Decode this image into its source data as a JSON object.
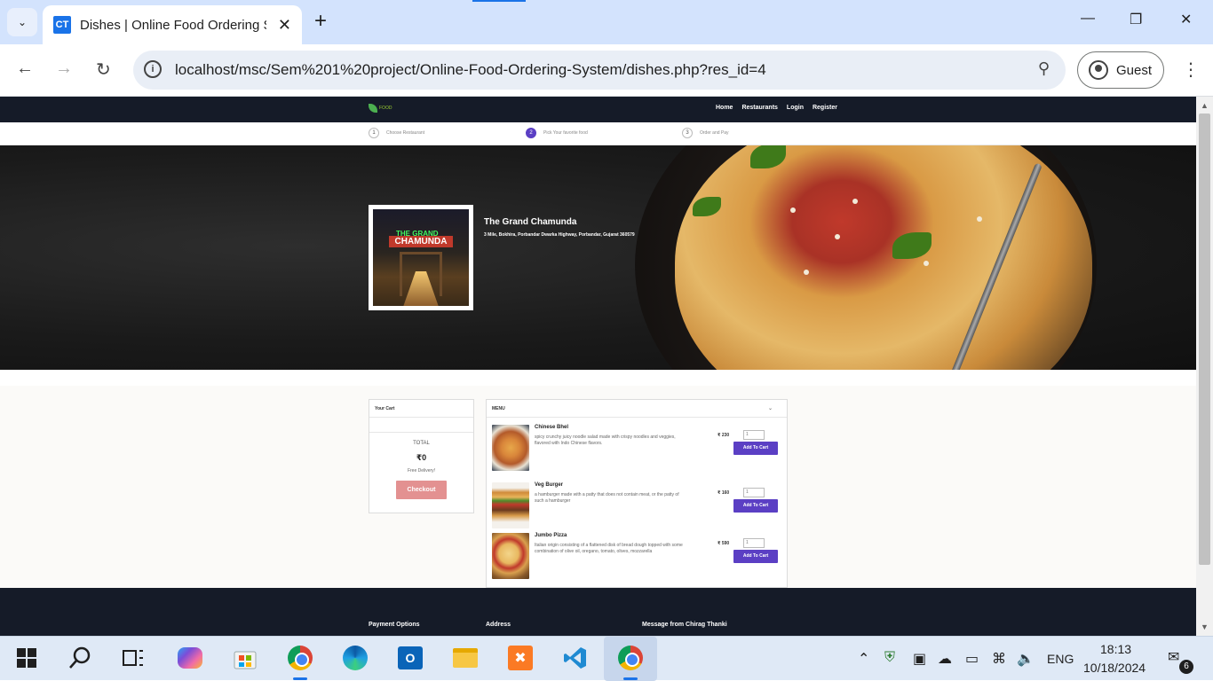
{
  "browser": {
    "tab": {
      "favicon": "CT",
      "title": "Dishes | Online Food Ordering S"
    },
    "url": "localhost/msc/Sem%201%20project/Online-Food-Ordering-System/dishes.php?res_id=4",
    "profile_label": "Guest"
  },
  "site": {
    "logo_text": "FOOD",
    "nav": [
      "Home",
      "Restaurants",
      "Login",
      "Register"
    ],
    "steps": [
      {
        "num": "1",
        "label": "Choose Restaurant"
      },
      {
        "num": "2",
        "label": "Pick Your favorite food"
      },
      {
        "num": "3",
        "label": "Order and Pay"
      }
    ],
    "restaurant": {
      "sign_top": "THE GRAND",
      "sign_main": "CHAMUNDA",
      "name": "The Grand Chamunda",
      "address": "3 Mile, Bokhira, Porbandar Dwarka Highway, Porbandar, Gujarat 360579"
    },
    "cart": {
      "title": "Your Cart",
      "total_label": "TOTAL",
      "total_value": "₹0",
      "delivery": "Free Delivery!",
      "checkout": "Checkout"
    },
    "menu": {
      "title": "MENU",
      "dishes": [
        {
          "name": "Chinese Bhel",
          "desc": "spicy crunchy juicy noodle salad made with crispy noodles and veggies, flavored with Indo Chinese flavors.",
          "price": "₹ 230",
          "qty": "1",
          "button": "Add To Cart"
        },
        {
          "name": "Veg Burger",
          "desc": "a hamburger made with a patty that does not contain meat, or the patty of such a hamburger",
          "price": "₹ 160",
          "qty": "1",
          "button": "Add To Cart"
        },
        {
          "name": "Jumbo Pizza",
          "desc": "Italian origin consisting of a flattened disk of bread dough topped with some combination of olive oil, oregano, tomato, olives, mozzarella",
          "price": "₹ 590",
          "qty": "1",
          "button": "Add To Cart"
        }
      ]
    },
    "footer": {
      "headings": [
        "Payment Options",
        "Address",
        "Message from Chirag Thanki"
      ]
    }
  },
  "taskbar": {
    "language": "ENG",
    "time": "18:13",
    "date": "10/18/2024",
    "notifications": "6"
  },
  "colors": {
    "accent": "#5b3fc4",
    "checkout": "#e39191",
    "site_dark": "#151b28"
  }
}
